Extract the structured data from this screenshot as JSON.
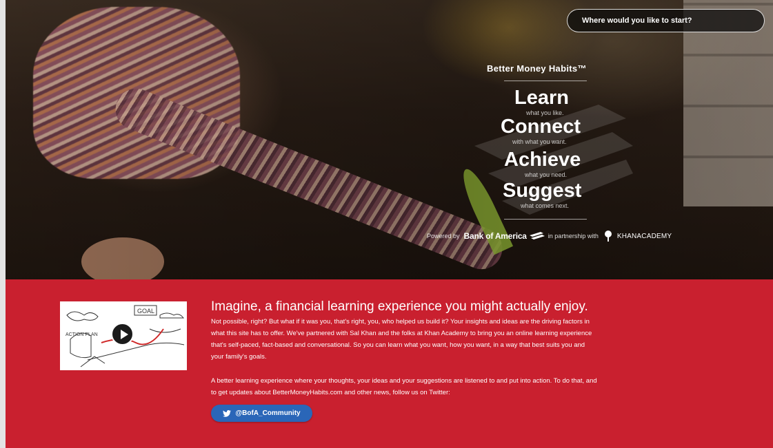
{
  "hero": {
    "search_prompt": "Where would you like to start?",
    "brand_title": "Better Money Habits™",
    "pillars": [
      {
        "word": "Learn",
        "sub": "what you like."
      },
      {
        "word": "Connect",
        "sub": "with what you want."
      },
      {
        "word": "Achieve",
        "sub": "what you need."
      },
      {
        "word": "Suggest",
        "sub": "what comes next."
      }
    ],
    "powered_by": "Powered by",
    "bank_name": "Bank of America",
    "partnership": "in partnership with",
    "khan_name": "KHANACADEMY"
  },
  "intro": {
    "video": {
      "goal_label": "GOAL",
      "action_plan_label": "ACTION PLAN"
    },
    "headline": "Imagine, a financial learning experience you might actually enjoy.",
    "paragraph1": "Not possible, right? But what if it was you, that's right, you, who helped us build it? Your insights and ideas are the driving factors in what this site has to offer. We've partnered with Sal Khan and the folks at Khan Academy to bring you an online learning experience that's self-paced, fact-based and conversational. So you can learn what you want, how you want, in a way that best suits you and your family's goals.",
    "paragraph2": "A better learning experience where your thoughts, your ideas and your suggestions are listened to and put into action. To do that, and to get updates about BetterMoneyHabits.com and other news, follow us on Twitter:",
    "twitter_handle": "@BofA_Community"
  },
  "colors": {
    "brand_red": "#c9202f",
    "twitter_blue": "#2a66b8"
  },
  "icons": [
    "play-icon",
    "twitter-bird-icon",
    "bank-of-america-flag-icon",
    "khan-academy-tree-icon"
  ]
}
